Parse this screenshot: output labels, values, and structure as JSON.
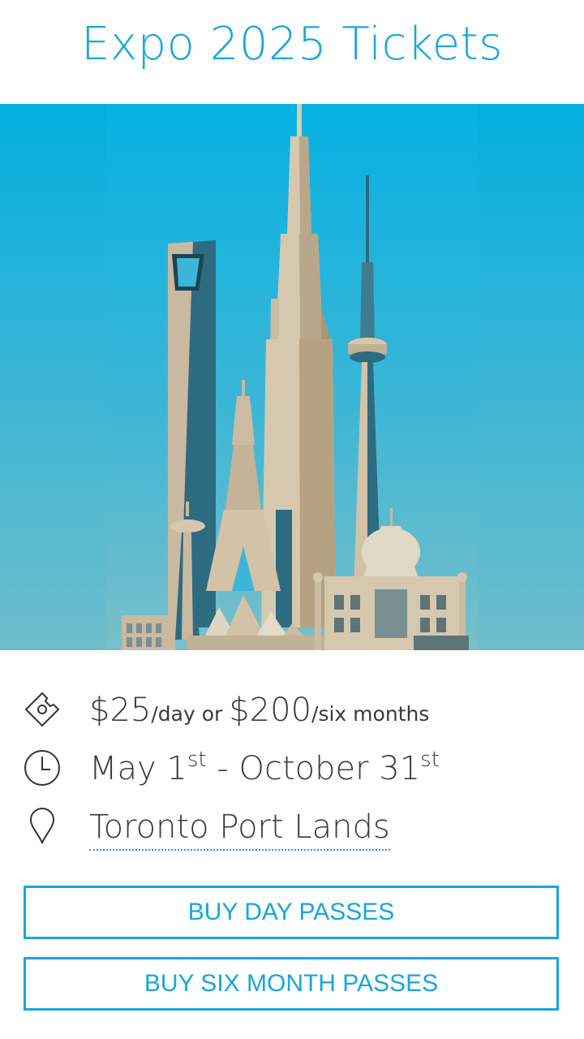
{
  "page": {
    "title": "Expo 2025 Tickets"
  },
  "details": {
    "price": {
      "day_amount": "$25",
      "day_unit": "/day or ",
      "six_amount": "$200",
      "six_unit": "/six months"
    },
    "dates": {
      "start": "May 1",
      "start_suffix": "st",
      "separator": " - October 31",
      "end_suffix": "st"
    },
    "location": {
      "label": "Toronto Port Lands"
    }
  },
  "buttons": {
    "day_passes": "BUY DAY PASSES",
    "six_month_passes": "BUY SIX MONTH PASSES"
  },
  "colors": {
    "accent": "#17a7dc",
    "text": "#3a3a3a"
  },
  "icons": {
    "price": "ticket-icon",
    "dates": "clock-icon",
    "location": "map-pin-icon"
  }
}
